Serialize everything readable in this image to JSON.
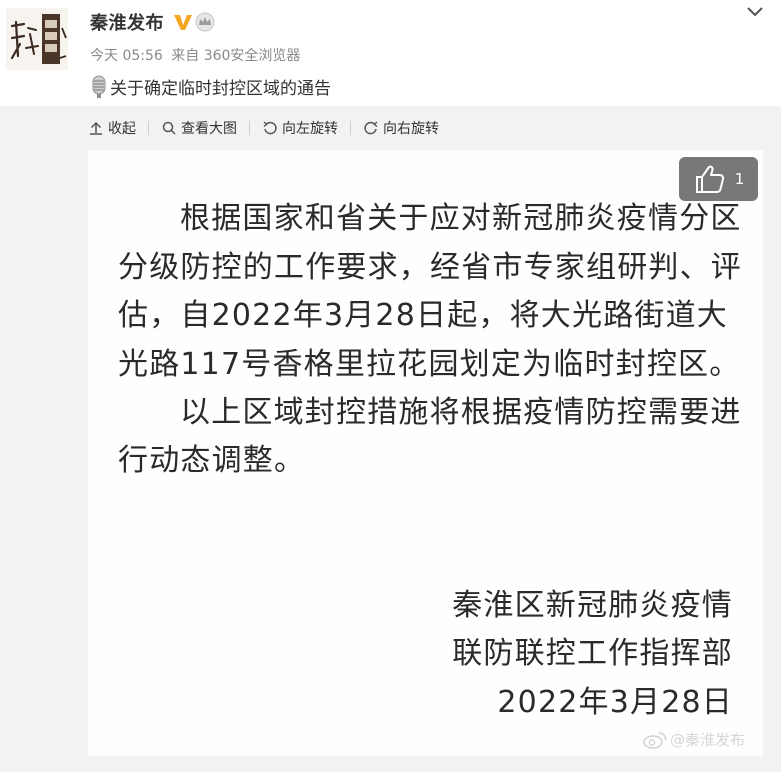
{
  "header": {
    "username": "秦淮发布",
    "verified_icon": "verified-v-icon",
    "member_icon": "crown-icon",
    "time": "今天 05:56",
    "source": "来自 360安全浏览器",
    "post_text": "关于确定临时封控区域的通告",
    "colors": {
      "verified": "#f5a623",
      "meta": "#8a8a8a"
    }
  },
  "toolbar": {
    "collapse": "收起",
    "view_large": "查看大图",
    "rotate_left": "向左旋转",
    "rotate_right": "向右旋转"
  },
  "document": {
    "lines": [
      "根据国家和省关于应对新冠肺炎疫情分区",
      "分级防控的工作要求，经省市专家组研判、评",
      "估，自2022年3月28日起，将大光路街道大",
      "光路117号香格里拉花园划定为临时封控区。",
      "以上区域封控措施将根据疫情防控需要进",
      "行动态调整。"
    ],
    "signature": [
      "秦淮区新冠肺炎疫情",
      "联防联控工作指挥部",
      "2022年3月28日"
    ]
  },
  "like": {
    "count": "1"
  },
  "watermark": {
    "text": "@秦淮发布"
  }
}
